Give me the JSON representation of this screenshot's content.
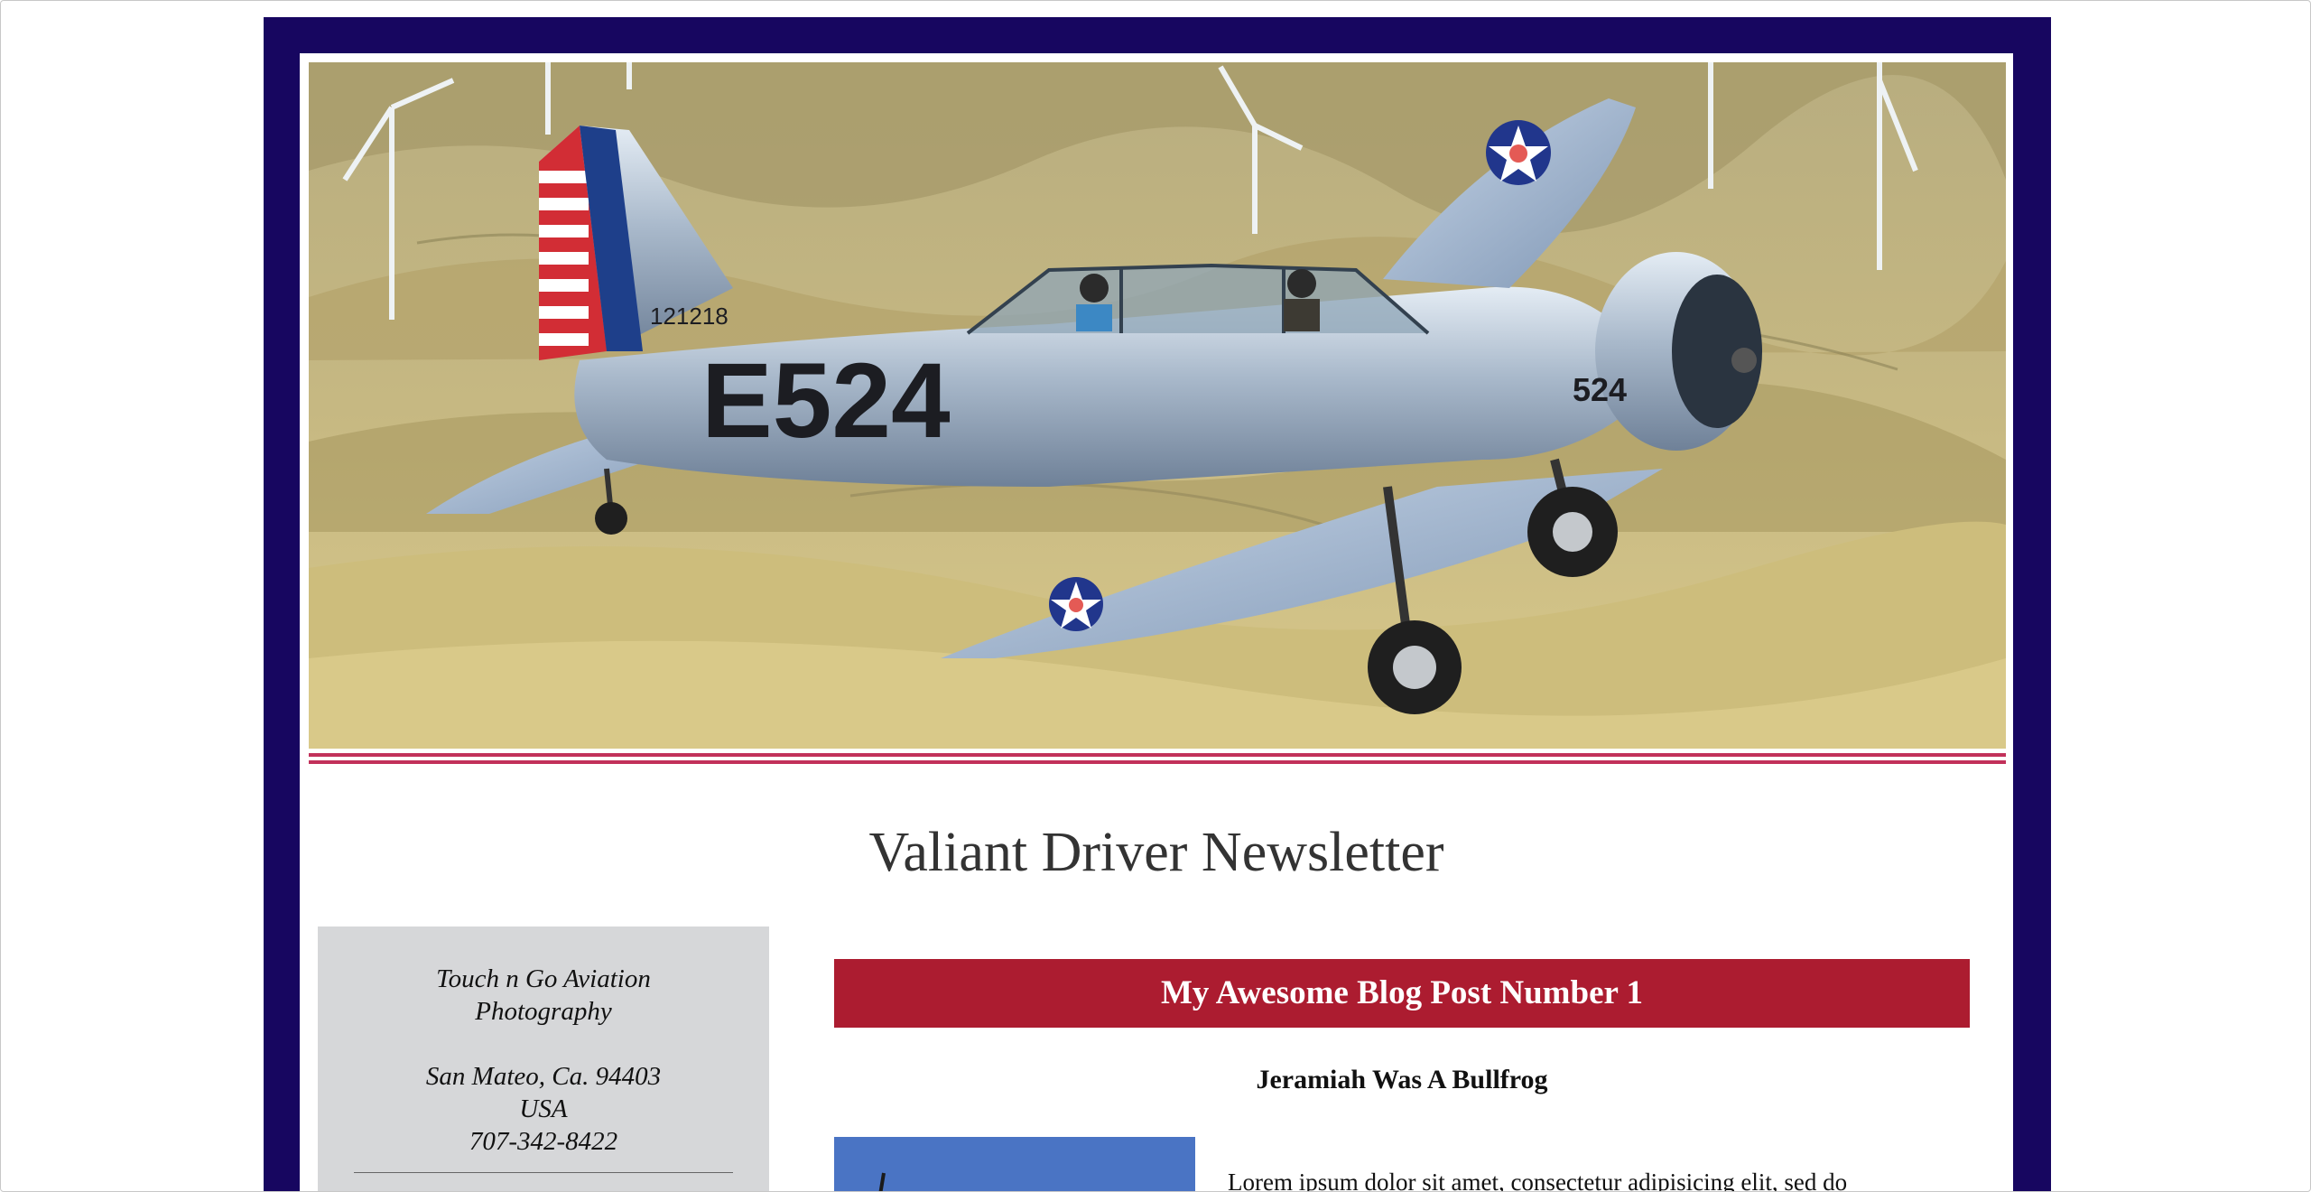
{
  "newsletter": {
    "title": "Valiant Driver Newsletter"
  },
  "hero": {
    "aircraft_tail_number": "121218",
    "aircraft_fuselage_code": "E524",
    "aircraft_cowl_number": "524"
  },
  "sidebar": {
    "address_lines": [
      "Touch n Go Aviation",
      "Photography",
      "",
      "San Mateo, Ca. 94403",
      "USA",
      "707-342-8422"
    ]
  },
  "post": {
    "header": "My Awesome Blog Post Number 1",
    "subtitle": "Jeramiah Was A Bullfrog",
    "body": "Lorem ipsum dolor sit amet, consectetur adipisicing elit, sed do"
  },
  "colors": {
    "frame": "#170660",
    "accent_rule": "#c2315a",
    "post_header": "#ac1c30",
    "sidebar": "#d6d7d9"
  }
}
